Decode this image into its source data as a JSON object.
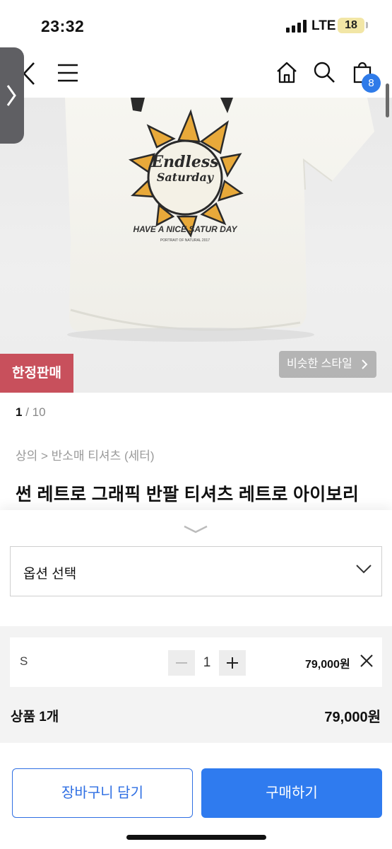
{
  "status_bar": {
    "time": "23:32",
    "network": "LTE",
    "battery": "18"
  },
  "nav": {
    "cart_count": "8"
  },
  "gallery": {
    "badge": "한정판매",
    "similar_style": "비슷한 스타일",
    "current_page": "1",
    "page_sep": " / ",
    "total_pages": "10",
    "print_text": [
      "Endless",
      "Saturday",
      "HAVE A NICE SATUR DAY",
      "PORTRAIT OF NATURAL 2017"
    ]
  },
  "product": {
    "breadcrumb": "상의 > 반소매 티셔츠 (세터)",
    "title": "썬 레트로 그래픽 반팔 티셔츠 레트로 아이보리"
  },
  "sheet": {
    "option_placeholder": "옵션 선택",
    "item": {
      "size": "S",
      "quantity": "1",
      "price": "79,000원"
    },
    "total_label": "상품 1개",
    "total_price": "79,000원",
    "cart_button": "장바구니 담기",
    "buy_button": "구매하기"
  },
  "colors": {
    "accent": "#2f7bef",
    "badge": "#c8505c",
    "cart_badge": "#2f7be9"
  }
}
